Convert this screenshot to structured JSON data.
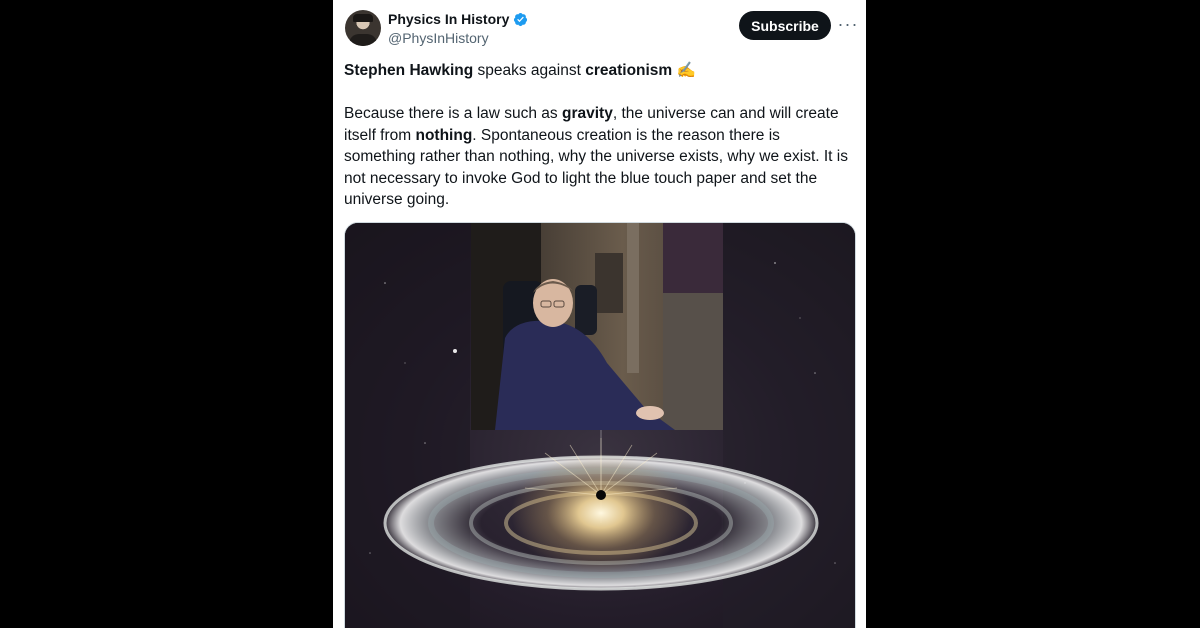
{
  "account": {
    "name": "Physics In History",
    "handle": "@PhysInHistory",
    "verified_icon": "verified-badge-icon",
    "avatar_icon": "avatar"
  },
  "actions": {
    "subscribe_label": "Subscribe",
    "more_label": "···"
  },
  "post": {
    "title_bold_1": "Stephen Hawking",
    "title_mid": " speaks against ",
    "title_bold_2": "creationism",
    "title_emoji": " ✍️",
    "body_1": "Because there is a law such as ",
    "body_bold_1": "gravity",
    "body_2": ", the universe can and will create itself from ",
    "body_bold_2": "nothing",
    "body_3": ". Spontaneous creation is the reason there is something rather than nothing, why the universe exists, why we exist. It is not necessary to invoke God to light the blue touch paper and set the universe going."
  },
  "colors": {
    "accent": "#1d9bf0",
    "button_bg": "#0f1419",
    "text": "#0f1419",
    "secondary_text": "#536471"
  }
}
